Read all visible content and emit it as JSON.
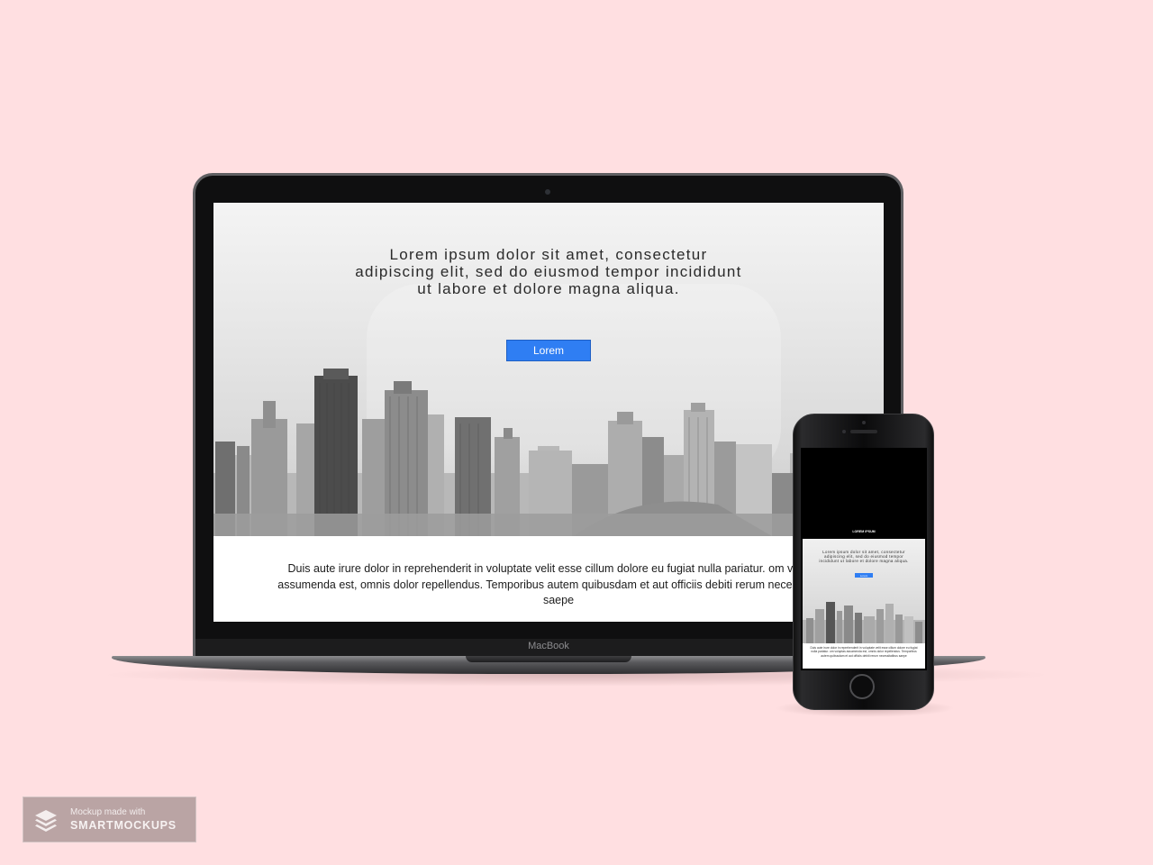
{
  "laptop": {
    "brand_label": "MacBook",
    "site": {
      "hero_heading": "Lorem ipsum dolor sit amet, consectetur adipiscing elit, sed do eiusmod tempor incididunt ut labore et dolore magna aliqua.",
      "cta_label": "Lorem",
      "content_text": "Duis aute irure dolor in reprehenderit in voluptate velit esse cillum dolore eu fugiat nulla pariatur. om voluptas assumenda est, omnis dolor repellendus. Temporibus autem quibusdam et aut officiis debiti rerum necessitatibus saepe"
    }
  },
  "phone": {
    "site": {
      "nav_title": "LOREM IPSUM",
      "hero_heading": "Lorem ipsum dolor sit amet, consectetur adipiscing elit, sed do eiusmod tempor incididunt ut labore et dolore magna aliqua.",
      "cta_label": "Lorem",
      "content_text": "Duis aute irure dolor in reprehenderit in voluptate velit esse cillum dolore eu fugiat nulla pariatur. om voluptas assumenda est, omnis dolor repellendus. Temporibus autem quibusdam et aut officiis debiti rerum necessitatibus saepe"
    }
  },
  "watermark": {
    "line1": "Mockup made with",
    "line2": "SMARTMOCKUPS",
    "icon": "layers-icon"
  },
  "colors": {
    "background": "#ffdfe1",
    "accent_button": "#2f7ef3"
  }
}
